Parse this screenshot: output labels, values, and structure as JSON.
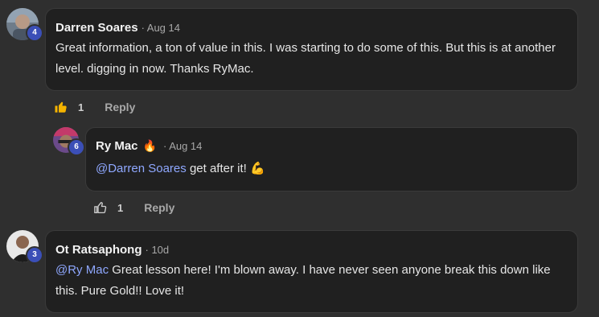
{
  "comments": [
    {
      "author": "Darren Soares",
      "date": "· Aug 14",
      "level": "4",
      "text": "Great information, a ton of value in this. I was starting to do some of this. But this is at another level. digging in now. Thanks RyMac.",
      "likes": "1",
      "reply_label": "Reply",
      "replies": [
        {
          "author": "Ry Mac",
          "flair": "🔥",
          "date": "· Aug 14",
          "level": "6",
          "mention": "@Darren Soares",
          "text": " get after it! ",
          "emoji": "💪",
          "likes": "1",
          "reply_label": "Reply"
        }
      ]
    },
    {
      "author": "Ot Ratsaphong",
      "date": "· 10d",
      "level": "3",
      "mention": "@Ry Mac",
      "text": " Great lesson here! I'm blown away. I have never seen anyone break this down like this. Pure Gold!! Love it!"
    }
  ]
}
